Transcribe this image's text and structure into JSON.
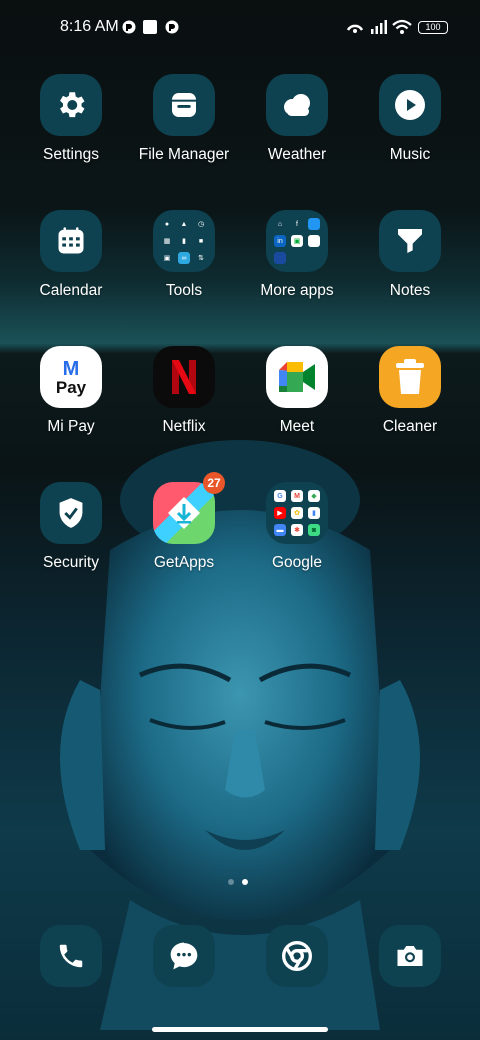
{
  "status_bar": {
    "time": "8:16 AM",
    "battery": "100"
  },
  "apps": {
    "settings": "Settings",
    "file_manager": "File Manager",
    "weather": "Weather",
    "music": "Music",
    "calendar": "Calendar",
    "tools": "Tools",
    "more_apps": "More apps",
    "notes": "Notes",
    "mi_pay": "Mi Pay",
    "netflix": "Netflix",
    "meet": "Meet",
    "cleaner": "Cleaner",
    "security": "Security",
    "getapps": "GetApps",
    "google": "Google"
  },
  "getapps_badge": "27",
  "mi_pay_logo": "Pay",
  "pager": {
    "pages": 2,
    "current": 2
  },
  "dock": [
    "phone-icon",
    "messages-icon",
    "browser-icon",
    "camera-icon"
  ],
  "colors": {
    "icon_bg": "#0e4250",
    "badge": "#e8562a",
    "cleaner": "#f5a623"
  }
}
